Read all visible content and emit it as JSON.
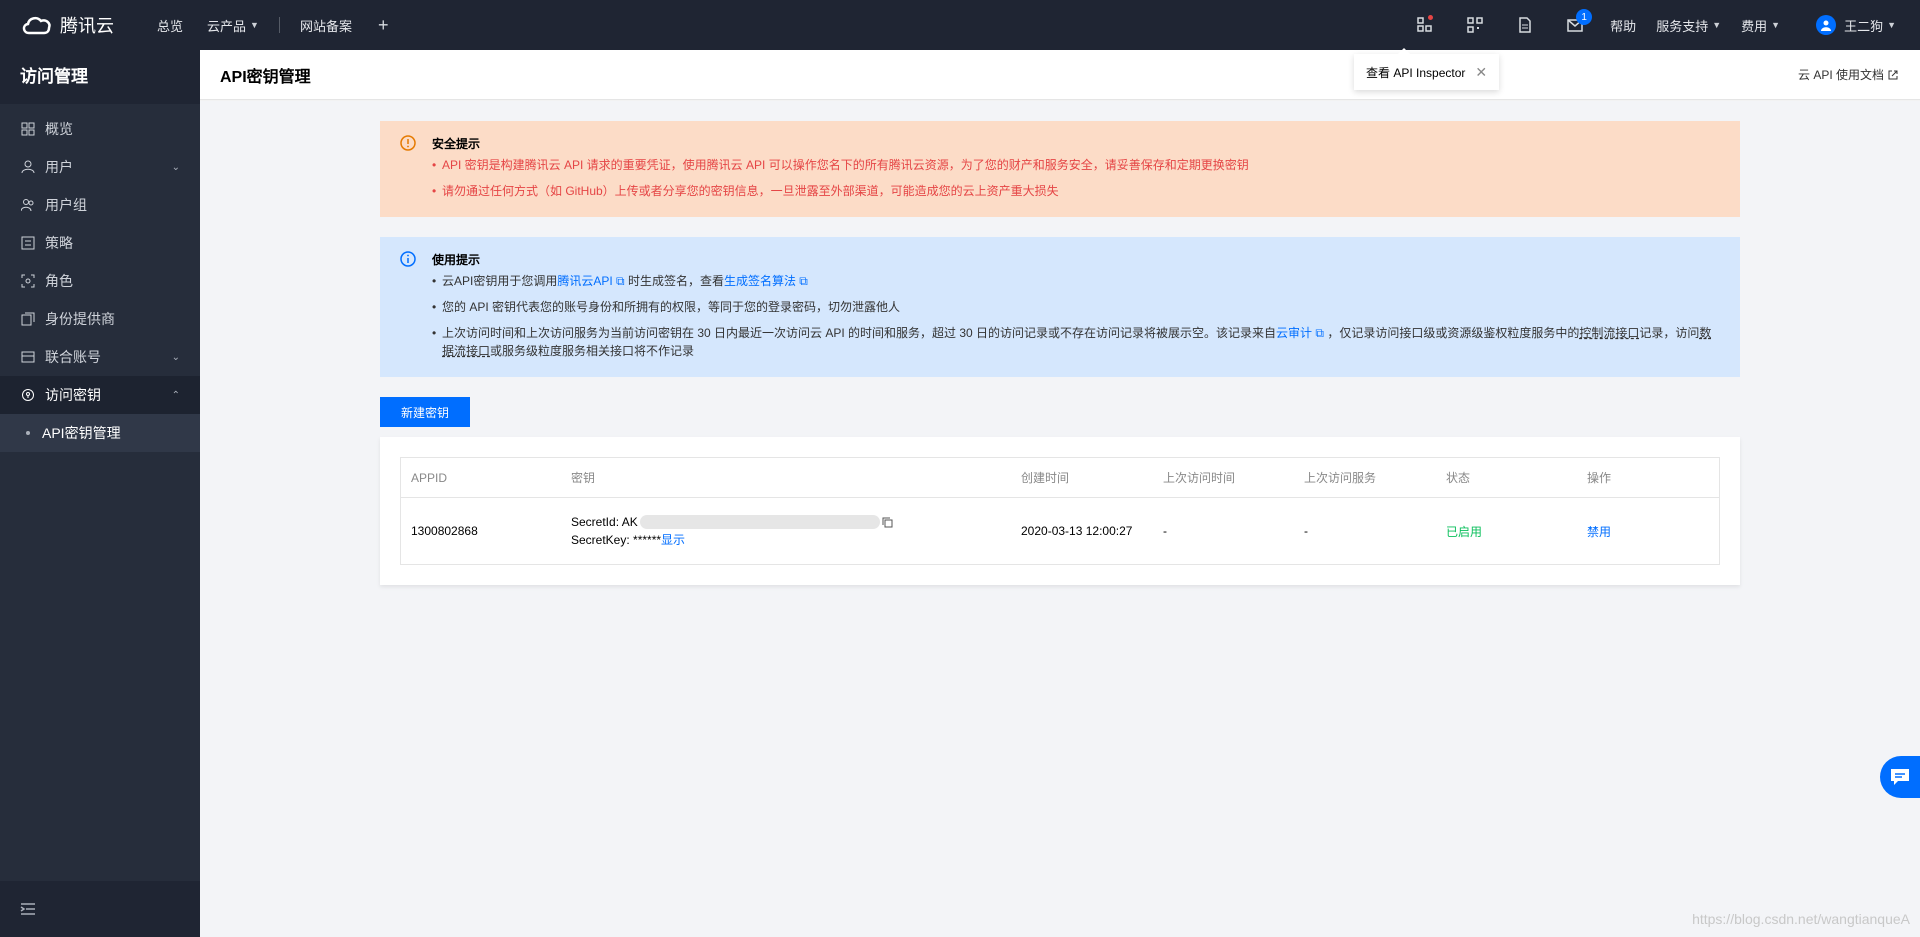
{
  "topbar": {
    "brand": "腾讯云",
    "nav": [
      "总览",
      "云产品",
      "网站备案"
    ],
    "help": "帮助",
    "support": "服务支持",
    "billing": "费用",
    "user": "王二狗",
    "mail_badge": "1"
  },
  "sidebar": {
    "title": "访问管理",
    "items": [
      {
        "label": "概览",
        "icon": "grid-icon"
      },
      {
        "label": "用户",
        "icon": "user-icon",
        "expandable": true
      },
      {
        "label": "用户组",
        "icon": "users-icon"
      },
      {
        "label": "策略",
        "icon": "policy-icon"
      },
      {
        "label": "角色",
        "icon": "role-icon"
      },
      {
        "label": "身份提供商",
        "icon": "provider-icon"
      },
      {
        "label": "联合账号",
        "icon": "federation-icon",
        "expandable": true
      },
      {
        "label": "访问密钥",
        "icon": "key-icon",
        "expandable": true,
        "open": true
      }
    ],
    "sub_item": "API密钥管理"
  },
  "header": {
    "title": "API密钥管理",
    "doc_link": "云 API 使用文档"
  },
  "tooltip": {
    "text": "查看 API Inspector"
  },
  "security_alert": {
    "title": "安全提示",
    "items": [
      "API 密钥是构建腾讯云 API 请求的重要凭证，使用腾讯云 API 可以操作您名下的所有腾讯云资源，为了您的财产和服务安全，请妥善保存和定期更换密钥",
      "请勿通过任何方式（如 GitHub）上传或者分享您的密钥信息，一旦泄露至外部渠道，可能造成您的云上资产重大损失"
    ]
  },
  "usage_alert": {
    "title": "使用提示",
    "line1_a": "云API密钥用于您调用",
    "line1_link1": "腾讯云API",
    "line1_b": "时生成签名，查看",
    "line1_link2": "生成签名算法",
    "line2": "您的 API 密钥代表您的账号身份和所拥有的权限，等同于您的登录密码，切勿泄露他人",
    "line3_a": "上次访问时间和上次访问服务为当前访问密钥在 30 日内最近一次访问云 API 的时间和服务，超过 30 日的访问记录或不存在访问记录将被展示空。该记录来自",
    "line3_link": "云审计",
    "line3_b": "，仅记录访问接口级或资源级鉴权粒度服务中的",
    "line3_u1": "控制流接口",
    "line3_c": "记录，访问",
    "line3_u2": "数据流接口",
    "line3_d": "或服务级粒度服务相关接口将不作记录"
  },
  "create_button": "新建密钥",
  "table": {
    "headers": [
      "APPID",
      "密钥",
      "创建时间",
      "上次访问时间",
      "上次访问服务",
      "状态",
      "操作"
    ],
    "rows": [
      {
        "appid": "1300802868",
        "secret_id_label": "SecretId: AK",
        "secret_key_label": "SecretKey: ******",
        "show": "显示",
        "created": "2020-03-13 12:00:27",
        "last_time": "-",
        "last_service": "-",
        "status": "已启用",
        "action": "禁用"
      }
    ]
  },
  "watermark": "https://blog.csdn.net/wangtianqueA",
  "colors": {
    "primary": "#006eff",
    "danger": "#e54545",
    "success": "#0abf5b"
  }
}
